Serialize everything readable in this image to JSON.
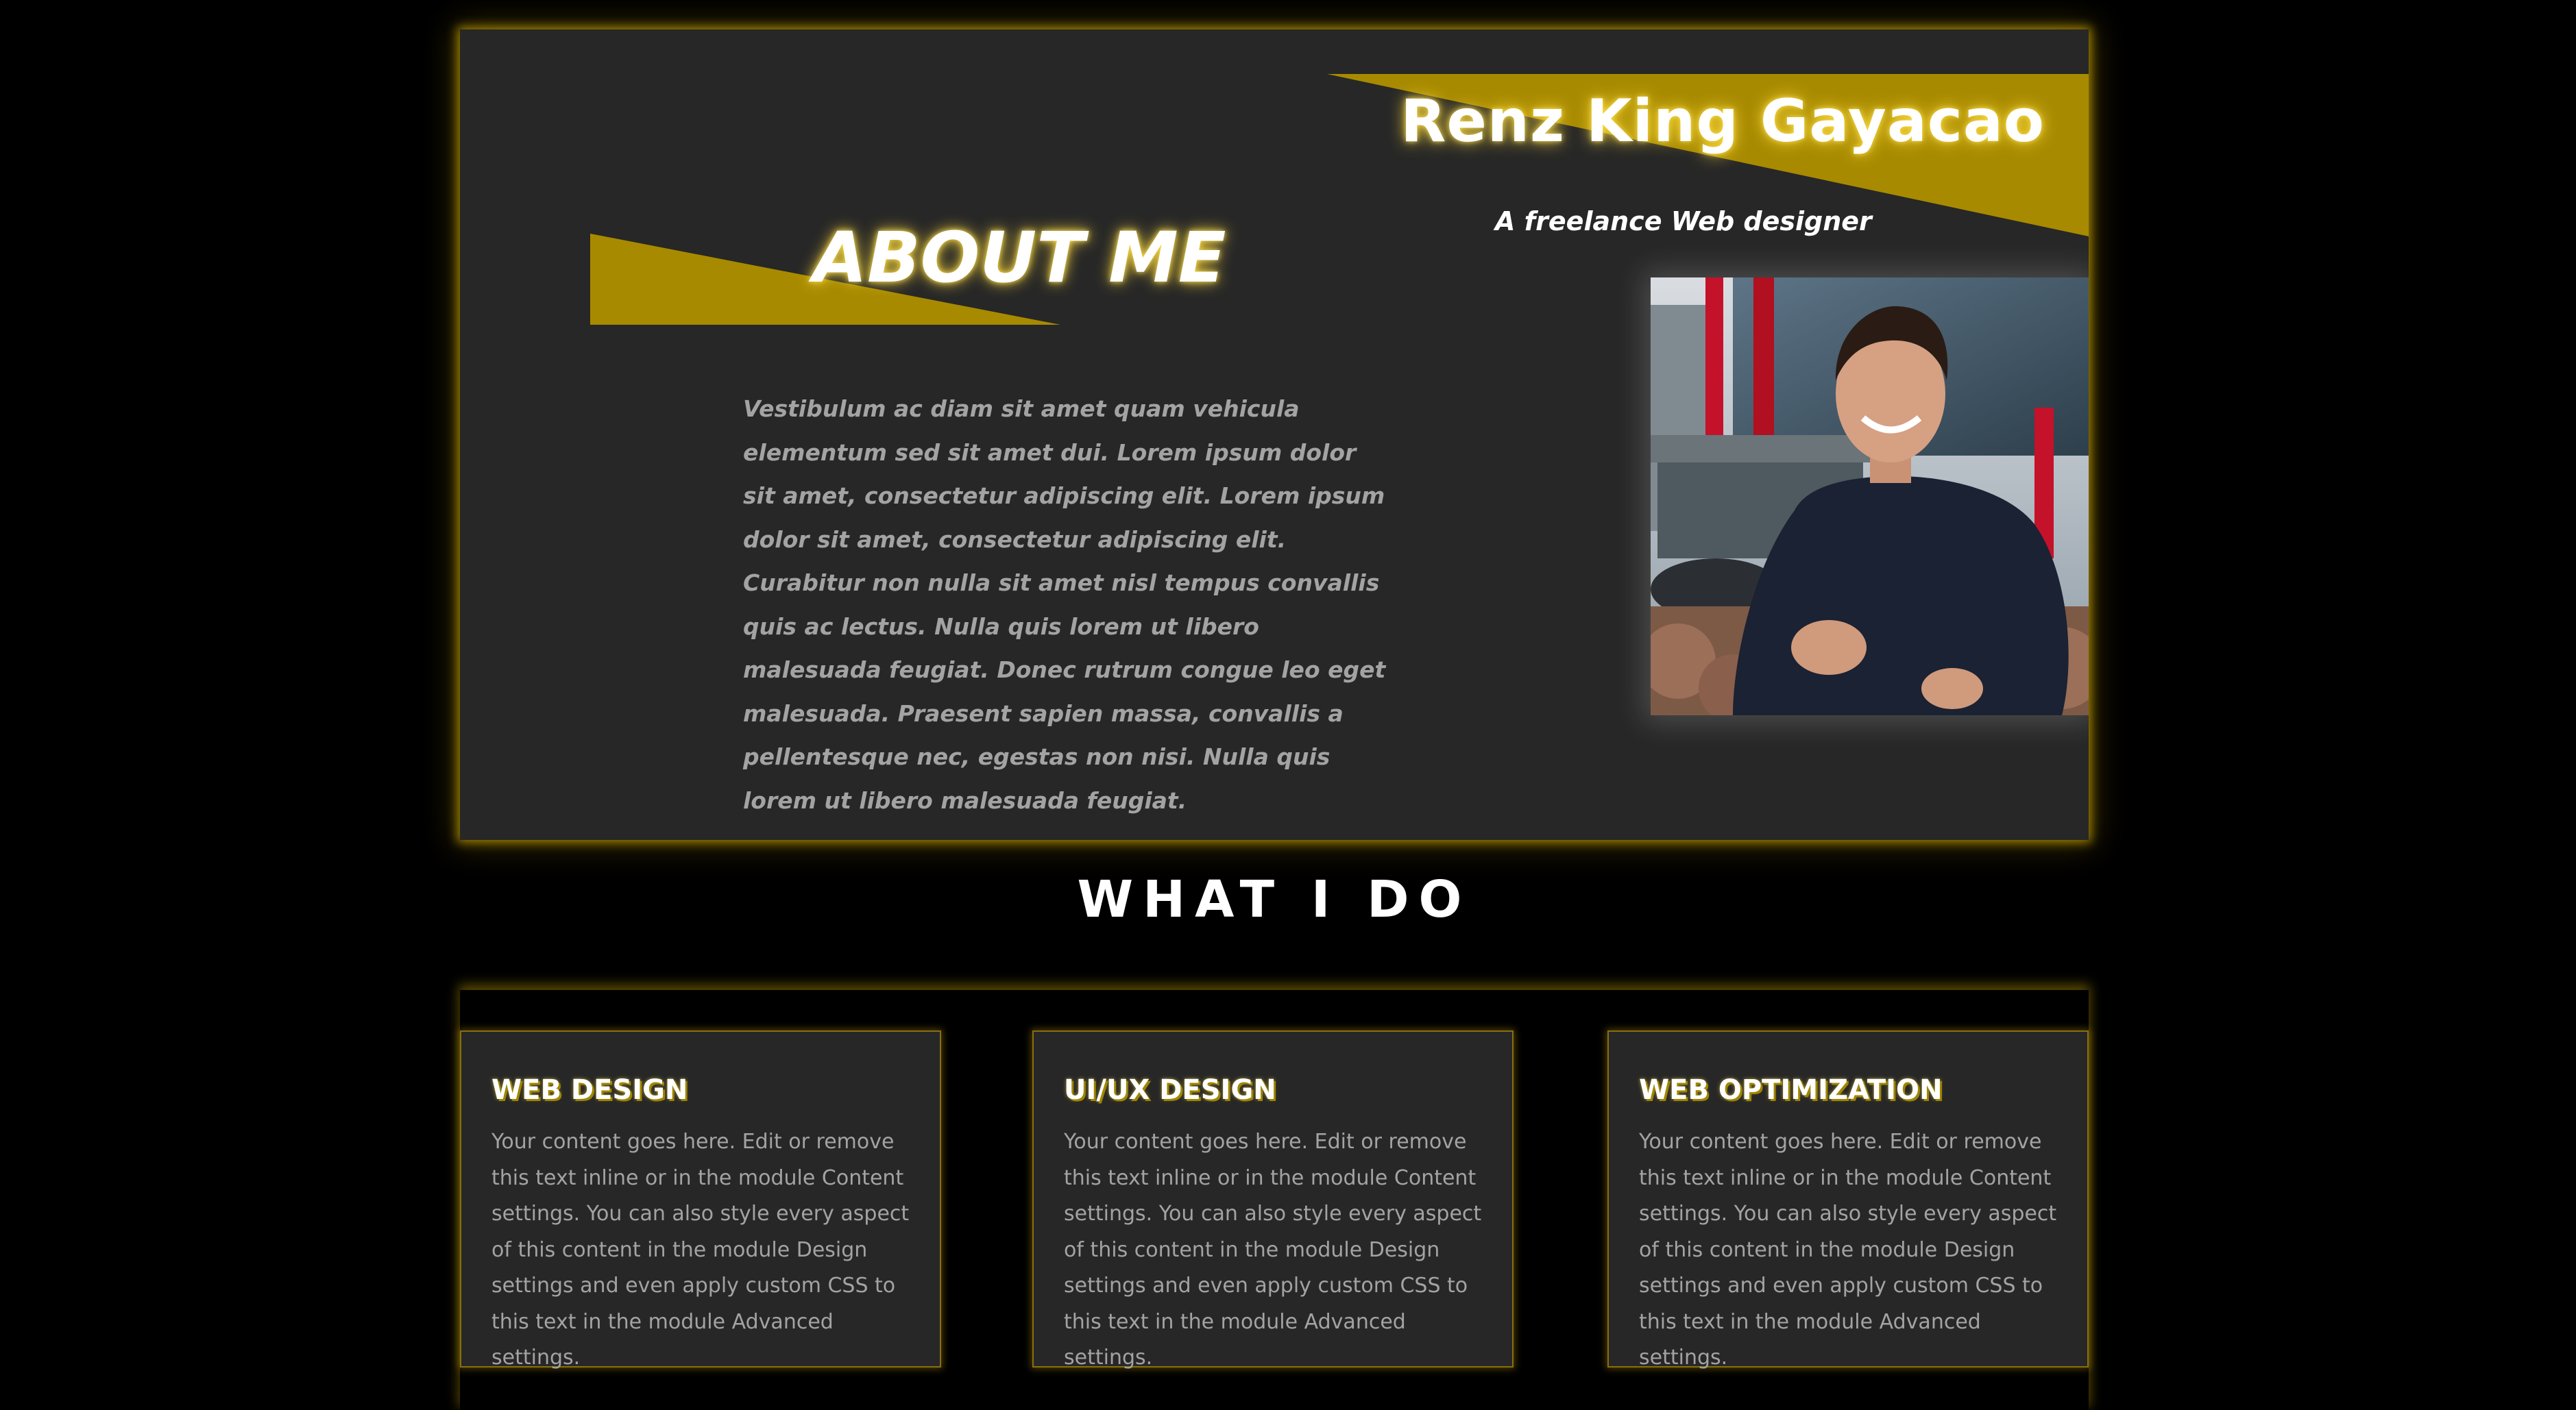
{
  "colors": {
    "page_background": "#000000",
    "panel_background": "#272727",
    "accent_gold": "#A88A00",
    "glow": "#FFD000",
    "text_primary": "#FFFFFF",
    "text_muted": "#A3A3A3"
  },
  "profile": {
    "name": "Renz King Gayacao",
    "tagline": "A freelance Web designer",
    "photo_icon": "portrait-photo"
  },
  "about": {
    "heading": "ABOUT ME",
    "body": "Vestibulum ac diam sit amet quam vehicula elementum sed sit amet dui. Lorem ipsum dolor sit amet, consectetur adipiscing elit. Lorem ipsum dolor sit amet, consectetur adipiscing elit. Curabitur non nulla sit amet nisl tempus convallis quis ac lectus. Nulla quis lorem ut libero malesuada feugiat. Donec rutrum congue leo eget malesuada. Praesent sapien massa, convallis a pellentesque nec, egestas non nisi. Nulla quis lorem ut libero malesuada feugiat."
  },
  "services": {
    "heading": "WHAT I DO",
    "cards": [
      {
        "title": "WEB DESIGN",
        "text": "Your content goes here. Edit or remove this text inline or in the module Content settings. You can also style every aspect of this content in the module Design settings and even apply custom CSS to this text in the module Advanced settings."
      },
      {
        "title": "UI/UX DESIGN",
        "text": "Your content goes here. Edit or remove this text inline or in the module Content settings. You can also style every aspect of this content in the module Design settings and even apply custom CSS to this text in the module Advanced settings."
      },
      {
        "title": "WEB OPTIMIZATION",
        "text": "Your content goes here. Edit or remove this text inline or in the module Content settings. You can also style every aspect of this content in the module Design settings and even apply custom CSS to this text in the module Advanced settings."
      }
    ]
  }
}
